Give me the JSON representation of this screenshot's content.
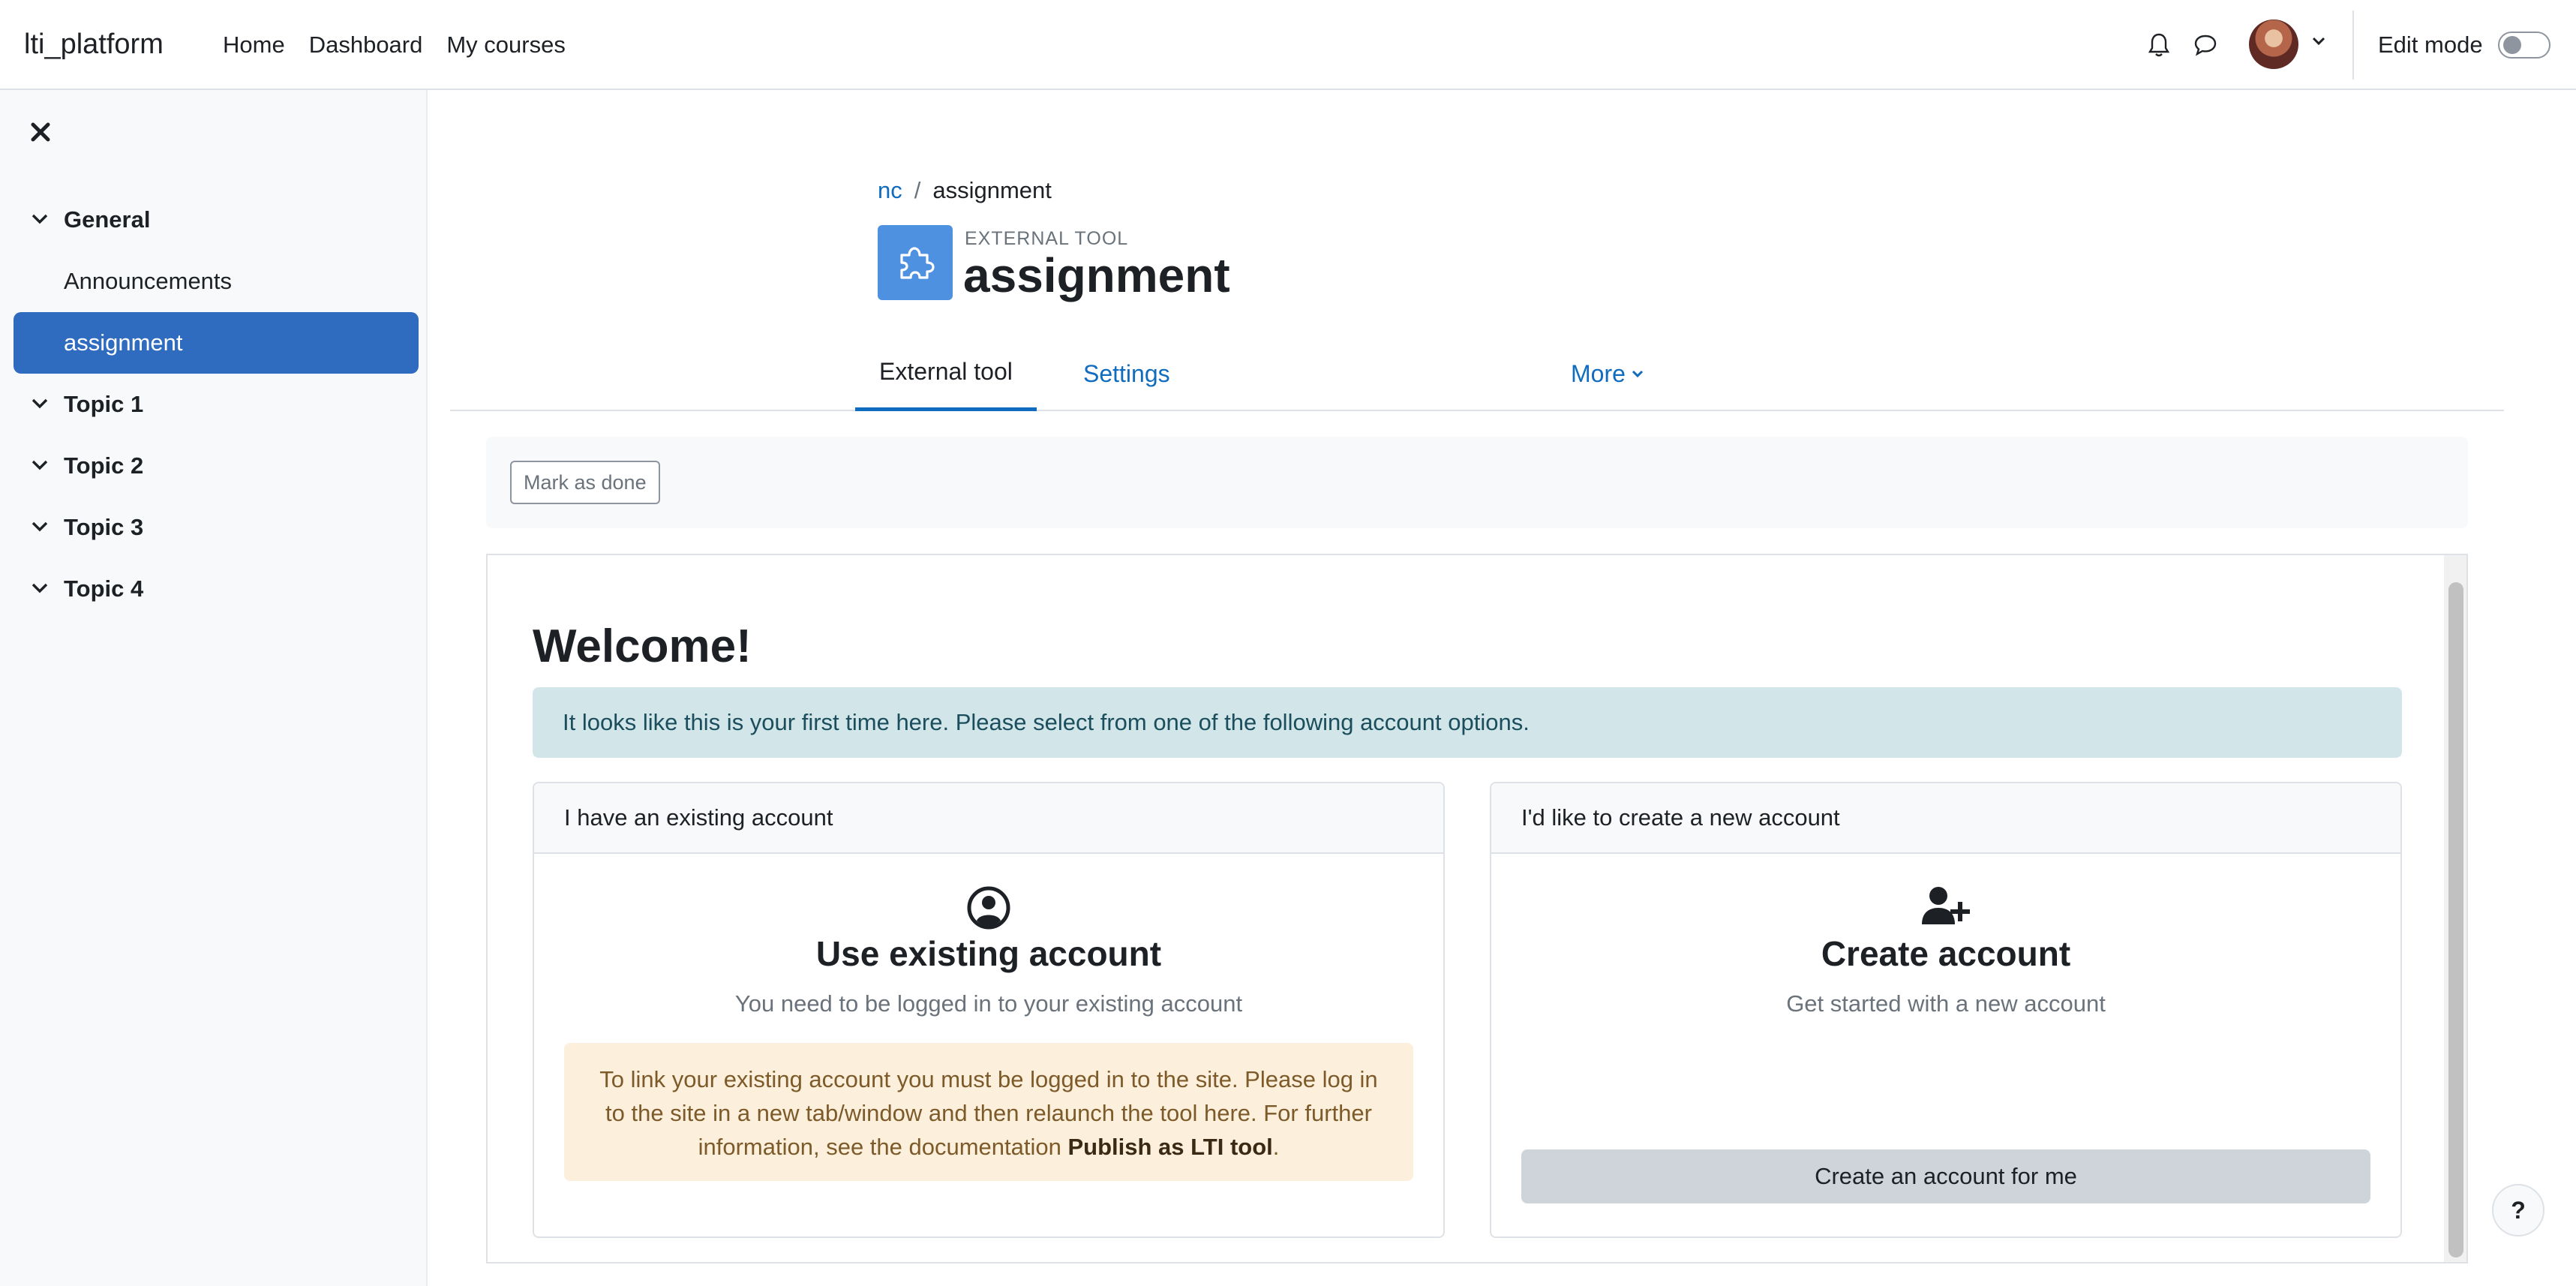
{
  "navbar": {
    "brand": "lti_platform",
    "links": [
      "Home",
      "Dashboard",
      "My courses"
    ],
    "icons": {
      "notifications": "bell-icon",
      "messages": "chat-bubble-icon",
      "user_menu": "chevron-down-icon"
    },
    "edit_mode_label": "Edit mode",
    "edit_mode_on": false
  },
  "drawer": {
    "close_icon": "close-icon",
    "items": [
      {
        "type": "section",
        "label": "General"
      },
      {
        "type": "activity",
        "label": "Announcements"
      },
      {
        "type": "activity",
        "label": "assignment",
        "active": true
      },
      {
        "type": "section",
        "label": "Topic 1"
      },
      {
        "type": "section",
        "label": "Topic 2"
      },
      {
        "type": "section",
        "label": "Topic 3"
      },
      {
        "type": "section",
        "label": "Topic 4"
      }
    ]
  },
  "header": {
    "breadcrumb": {
      "course": "nc",
      "separator": "/",
      "current": "assignment"
    },
    "activity_type": "EXTERNAL TOOL",
    "title": "assignment",
    "icon": "puzzle-piece-icon",
    "accent_color": "#4e91e0"
  },
  "tabs": [
    {
      "label": "External tool",
      "active": true
    },
    {
      "label": "Settings"
    },
    {
      "label": "More"
    }
  ],
  "completion": {
    "button_label": "Mark as done"
  },
  "tool": {
    "welcome": "Welcome!",
    "info": "It looks like this is your first time here. Please select from one of the following account options.",
    "existing": {
      "header": "I have an existing account",
      "title": "Use existing account",
      "subtitle": "You need to be logged in to your existing account",
      "warning": "To link your existing account you must be logged in to the site. Please log in to the site in a new tab/window and then relaunch the tool here. For further information, see the documentation",
      "warning_link": "Publish as LTI tool",
      "warning_end": ".",
      "icon": "user-circle-icon"
    },
    "create": {
      "header": "I'd like to create a new account",
      "title": "Create account",
      "subtitle": "Get started with a new account",
      "button": "Create an account for me",
      "icon": "user-plus-icon"
    }
  },
  "help": {
    "label": "?"
  },
  "colors": {
    "primary": "#0f6cbf",
    "drawer_active": "#2f6bbf",
    "info_bg": "#d2e6ea",
    "warning_bg": "#fcefdc"
  }
}
